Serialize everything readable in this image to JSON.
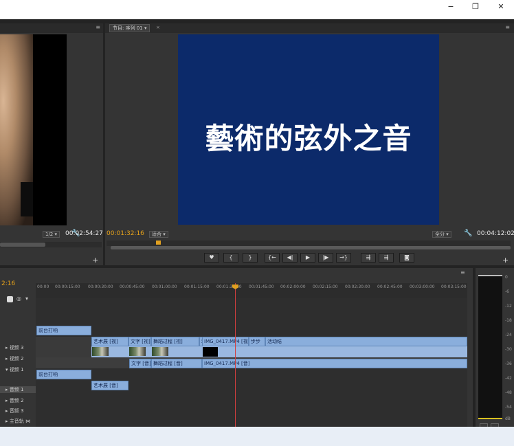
{
  "window": {
    "minimize": "−",
    "restore": "❐",
    "close": "✕"
  },
  "source": {
    "zoom": "1/2",
    "duration": "00:02:54:27"
  },
  "program": {
    "tab_label": "节目: 序列 01",
    "title_text": "藝術的弦外之音",
    "current_time": "00:01:32:16",
    "fit": "适合",
    "quality": "全分",
    "duration": "00:04:12:02"
  },
  "timeline": {
    "timecode": "2:16",
    "ruler": [
      "00:00",
      "00:00:15:00",
      "00:00:30:00",
      "00:00:45:00",
      "00:01:00:00",
      "00:01:15:00",
      "00:01:30:00",
      "00:01:45:00",
      "00:02:00:00",
      "00:02:15:00",
      "00:02:30:00",
      "00:02:45:00",
      "00:03:00:00",
      "00:03:15:00"
    ],
    "tracks": [
      {
        "name": "视频 3"
      },
      {
        "name": "视频 2"
      },
      {
        "name": "视频 1"
      },
      {
        "name": "音频 1"
      },
      {
        "name": "音频 2"
      },
      {
        "name": "音频 3"
      },
      {
        "name": "主音轨"
      }
    ],
    "clips": {
      "v2_a": "前台打响",
      "v1_a": "艺术展 [视]",
      "v1_b": "文字 [视]",
      "v1_c": "舞蹈过程 [视]",
      "v1_d": "利路",
      "v1_e": "IMG_0417.MP4 [视]",
      "v1_f": "步步",
      "v1_g": "活动结",
      "a1_a": "文字 [音]",
      "a1_b": "舞蹈过程 [音]",
      "a1_c": "IMG_0417.MP4 [音]",
      "a2_a": "前台打响",
      "a3_a": "艺术展 [音]"
    }
  },
  "meter_scale": [
    "0",
    "-6",
    "-12",
    "-18",
    "-24",
    "-30",
    "-36",
    "-42",
    "-48",
    "-54",
    "dB"
  ],
  "transport": [
    "♥",
    "{",
    "}",
    "{←",
    "◀|",
    "▶",
    "|▶",
    "→}",
    "⇶",
    "⇶",
    "◙"
  ]
}
